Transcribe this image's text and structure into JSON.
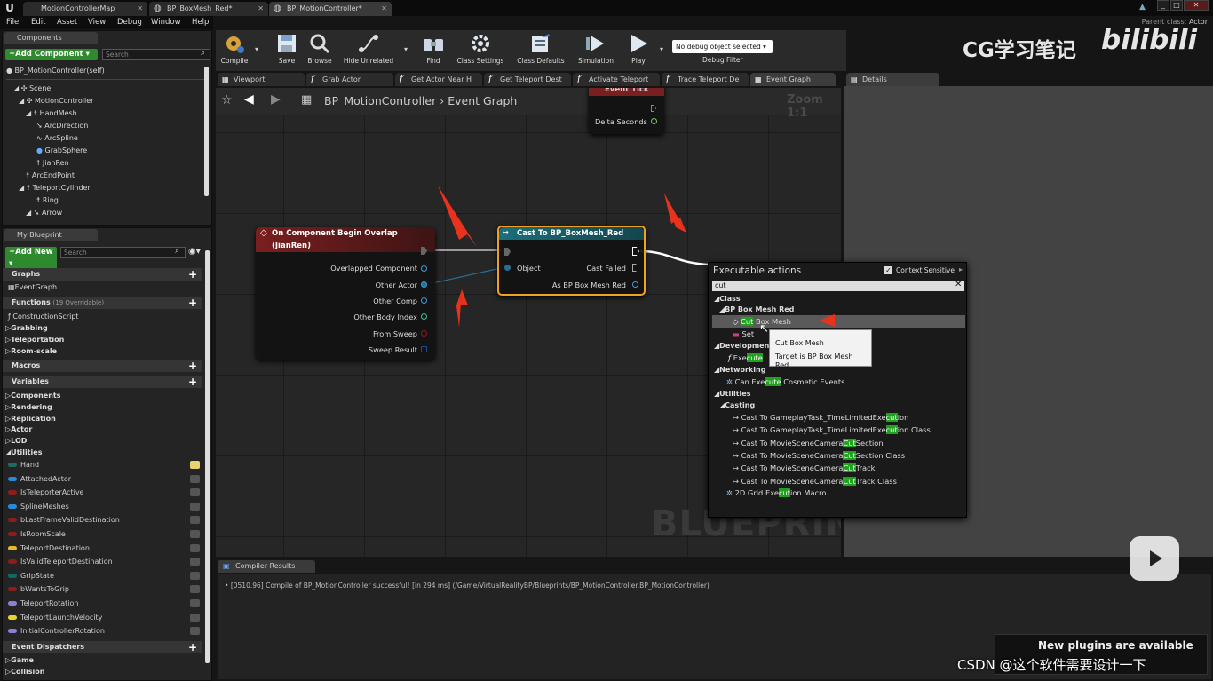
{
  "window": {
    "tabs": [
      "MotionControllerMap",
      "BP_BoxMesh_Red*",
      "BP_MotionController*"
    ],
    "parent_class_label": "Parent class:",
    "parent_class_value": "Actor"
  },
  "menubar": [
    "File",
    "Edit",
    "Asset",
    "View",
    "Debug",
    "Window",
    "Help"
  ],
  "components": {
    "title": "Components",
    "add_label": "+Add Component ▾",
    "search_placeholder": "Search",
    "self_label": "BP_MotionController(self)",
    "tree": [
      "Scene",
      "MotionController",
      "HandMesh",
      "ArcDirection",
      "ArcSpline",
      "GrabSphere",
      "JianRen",
      "ArcEndPoint",
      "TeleportCylinder",
      "Ring",
      "Arrow"
    ]
  },
  "myblueprint": {
    "title": "My Blueprint",
    "add_label": "+Add New ▾",
    "search_placeholder": "Search",
    "graphs_label": "Graphs",
    "event_graph": "EventGraph",
    "functions_label": "Functions",
    "functions_count": "(19 Overridable)",
    "functions": [
      "ConstructionScript",
      "Grabbing",
      "Teleportation",
      "Room-scale"
    ],
    "macros_label": "Macros",
    "variables_label": "Variables",
    "variable_categories": [
      "Components",
      "Rendering",
      "Replication",
      "Actor",
      "LOD",
      "Utilities"
    ],
    "variables": [
      {
        "name": "Hand",
        "color": "#1e6b63"
      },
      {
        "name": "AttachedActor",
        "color": "#2a8ad8"
      },
      {
        "name": "IsTeleporterActive",
        "color": "#8c1d1d"
      },
      {
        "name": "SplineMeshes",
        "color": "#2a8ad8"
      },
      {
        "name": "bLastFrameValidDestination",
        "color": "#8c1d1d"
      },
      {
        "name": "IsRoomScale",
        "color": "#8c1d1d"
      },
      {
        "name": "TeleportDestination",
        "color": "#e8b82a"
      },
      {
        "name": "IsValidTeleportDestination",
        "color": "#8c1d1d"
      },
      {
        "name": "GripState",
        "color": "#0d6c62"
      },
      {
        "name": "bWantsToGrip",
        "color": "#8c1d1d"
      },
      {
        "name": "TeleportRotation",
        "color": "#8b7fd6"
      },
      {
        "name": "TeleportLaunchVelocity",
        "color": "#e8d42a"
      },
      {
        "name": "InitialControllerRotation",
        "color": "#8b7fd6"
      }
    ],
    "dispatchers_label": "Event Dispatchers",
    "bottom_categories": [
      "Game",
      "Collision"
    ]
  },
  "toolbar": {
    "buttons": [
      "Compile",
      "Save",
      "Browse",
      "Hide Unrelated",
      "Find",
      "Class Settings",
      "Class Defaults",
      "Simulation",
      "Play"
    ],
    "debug_select": "No debug object selected ▾",
    "debug_filter": "Debug Filter"
  },
  "doc_tabs": [
    "Viewport",
    "Grab Actor",
    "Get Actor Near H",
    "Get Teleport Dest",
    "Activate Teleport",
    "Trace Teleport De",
    "Event Graph"
  ],
  "details_tab": "Details",
  "graph": {
    "breadcrumb_bp": "BP_MotionController",
    "breadcrumb_sep": "›",
    "breadcrumb_graph": "Event Graph",
    "zoom": "Zoom 1:1",
    "watermark": "BLUEPRINT",
    "event_tick": {
      "title": "Event Tick",
      "pin": "Delta Seconds"
    },
    "overlap_node": {
      "title": "On Component Begin Overlap (JianRen)",
      "pins": [
        "Overlapped Component",
        "Other Actor",
        "Other Comp",
        "Other Body Index",
        "From Sweep",
        "Sweep Result"
      ]
    },
    "cast_node": {
      "title": "Cast To BP_BoxMesh_Red",
      "object": "Object",
      "failed": "Cast Failed",
      "as": "As BP Box Mesh Red"
    }
  },
  "context_menu": {
    "title": "Executable actions",
    "sensitive_label": "Context Sensitive",
    "search_value": "cut",
    "cat_class": "Class",
    "cat_bp": "BP Box Mesh Red",
    "item_cut_pre": "Cut",
    "item_cut_post": " Box Mesh",
    "item_set": "Set",
    "cat_dev": "Development",
    "item_exec_pre": "Exe",
    "item_exec_hl": "cute",
    "cat_net": "Networking",
    "item_net_pre": "Can Exe",
    "item_net_hl": "cute",
    "item_net_post": " Cosmetic Events",
    "cat_util": "Utilities",
    "cat_cast": "Casting",
    "cast_items": [
      [
        "Cast To GameplayTask_TimeLimitedExe",
        "cut",
        "ion"
      ],
      [
        "Cast To GameplayTask_TimeLimitedExe",
        "cut",
        "ion Class"
      ],
      [
        "Cast To MovieSceneCamera",
        "Cut",
        "Section"
      ],
      [
        "Cast To MovieSceneCamera",
        "Cut",
        "Section Class"
      ],
      [
        "Cast To MovieSceneCamera",
        "Cut",
        "Track"
      ],
      [
        "Cast To MovieSceneCamera",
        "Cut",
        "Track Class"
      ]
    ],
    "item_grid_pre": "2D Grid Exe",
    "item_grid_hl": "cut",
    "item_grid_post": "ion Macro"
  },
  "tooltip": {
    "line1": "Cut Box Mesh",
    "line2": "Target is BP Box Mesh Red"
  },
  "compiler": {
    "tab": "Compiler Results",
    "message": "[0510.96] Compile of BP_MotionController successful! [in 294 ms] (/Game/VirtualRealityBP/Blueprints/BP_MotionController.BP_MotionController)"
  },
  "overlay": {
    "watermark_cn": "CG学习笔记",
    "watermark_bili": "bilibili",
    "plugins_text": "New plugins are available",
    "csdn": "CSDN @这个软件需要设计一下"
  }
}
